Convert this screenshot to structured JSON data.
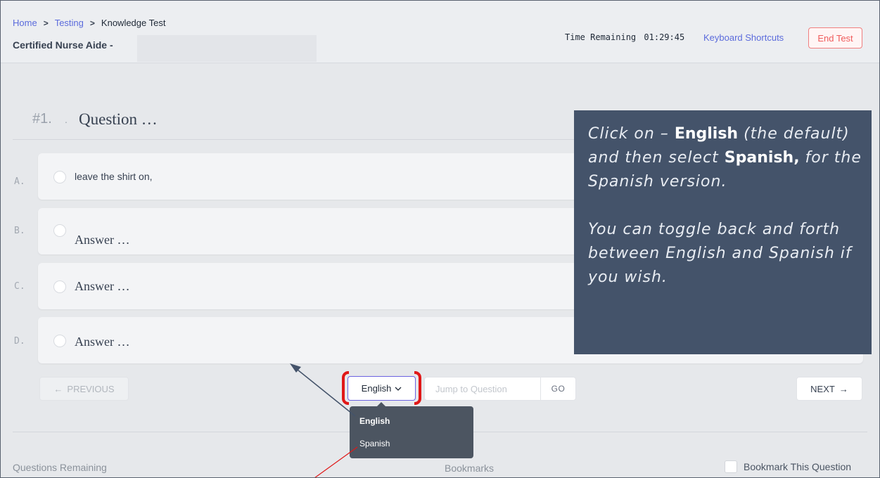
{
  "breadcrumb": {
    "home": "Home",
    "testing": "Testing",
    "current": "Knowledge Test",
    "separator": ">"
  },
  "exam_title": "Certified Nurse Aide -",
  "timer": {
    "label": "Time Remaining",
    "value": "01:29:45"
  },
  "header_links": {
    "shortcuts": "Keyboard Shortcuts",
    "end_test": "End Test"
  },
  "question": {
    "number": "#1.",
    "text": "Question …"
  },
  "options": [
    {
      "letter": "A.",
      "text": "leave the shirt on,"
    },
    {
      "letter": "B.",
      "text": "Answer …"
    },
    {
      "letter": "C.",
      "text": "Answer …"
    },
    {
      "letter": "D.",
      "text": "Answer …"
    }
  ],
  "nav": {
    "previous": "PREVIOUS",
    "language": "English",
    "jump_placeholder": "Jump to Question",
    "go": "GO",
    "next": "NEXT"
  },
  "language_menu": [
    "English",
    "Spanish"
  ],
  "footer": {
    "questions_remaining": "Questions Remaining",
    "bookmarks": "Bookmarks",
    "bookmark_question": "Bookmark This Question"
  },
  "callout": {
    "p1_a": "Click on – ",
    "p1_b": "English",
    "p1_c": " (the default) and then select ",
    "p1_d": "Spanish,",
    "p1_e": " for the Spanish version.",
    "p2": "You can toggle back and forth between English and Spanish if you wish."
  },
  "colors": {
    "accent": "#5b6bdc",
    "danger": "#f05c5c",
    "callout_bg": "#44536a",
    "highlight": "#e01818"
  },
  "icons": {
    "arrow_left": "arrow-left-icon",
    "arrow_right": "arrow-right-icon",
    "chevron": "chevron-down-icon"
  }
}
